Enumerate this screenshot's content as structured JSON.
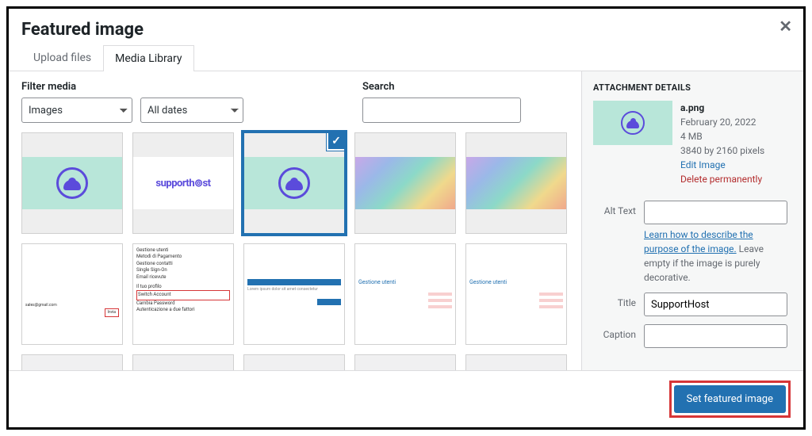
{
  "modal": {
    "title": "Featured image",
    "close": "✕"
  },
  "tabs": {
    "upload": "Upload files",
    "library": "Media Library"
  },
  "filters": {
    "label": "Filter media",
    "type": "Images",
    "date": "All dates"
  },
  "search": {
    "label": "Search"
  },
  "sidebar": {
    "heading": "ATTACHMENT DETAILS",
    "filename": "a.png",
    "date": "February 20, 2022",
    "size": "4 MB",
    "dims": "3840 by 2160 pixels",
    "edit": "Edit Image",
    "delete": "Delete permanently",
    "fields": {
      "alt_label": "Alt Text",
      "alt_value": "",
      "alt_help_link": "Learn how to describe the purpose of the image.",
      "alt_help_rest": " Leave empty if the image is purely decorative.",
      "title_label": "Title",
      "title_value": "SupportHost",
      "caption_label": "Caption",
      "caption_value": ""
    }
  },
  "footer": {
    "button": "Set featured image"
  },
  "thumbs": {
    "t2_text": "supporth⊚st",
    "t6": [
      "Gestione utenti",
      "Metodi di Pagamento",
      "Gestione contatti",
      "Single Sign-On",
      "Email ricevute",
      "",
      "Il tuo profilo",
      "Switch Account",
      "Cambia Password",
      "Autenticazione a due fattori"
    ],
    "t8_title": "Gestione utenti",
    "t9_title": "Gestione utenti"
  }
}
